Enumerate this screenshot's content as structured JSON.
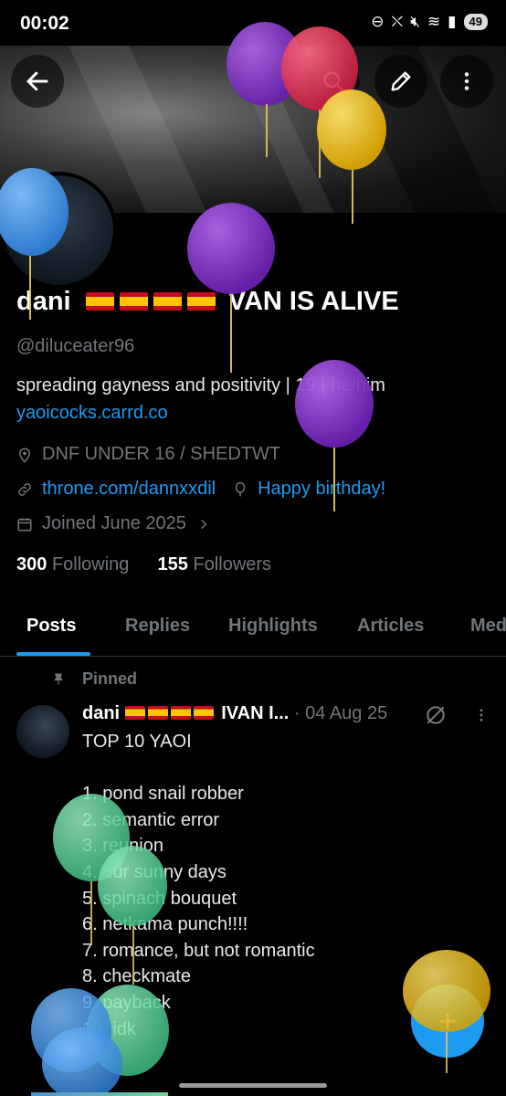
{
  "status_bar": {
    "time": "00:02",
    "battery": "49",
    "signal_label": "5"
  },
  "header": {
    "back_icon": "arrow-left-icon",
    "search_icon": "search-icon",
    "edit_icon": "pencil-icon",
    "more_icon": "more-vertical-icon"
  },
  "profile": {
    "display_name_text": "VAN IS ALIVE",
    "display_name_prefix": "dani",
    "handle": "@diluceater96",
    "bio": "spreading gayness and positivity | 19 | he/him",
    "bio_link": "yaoicocks.carrd.co",
    "location": "DNF UNDER 16 / SHEDTWT",
    "website": "throne.com/dannxxdil",
    "birthday": "Happy birthday!",
    "joined": "Joined June 2025",
    "following_count": "300",
    "following_label": "Following",
    "followers_count": "155",
    "followers_label": "Followers"
  },
  "tabs": [
    {
      "label": "Posts"
    },
    {
      "label": "Replies"
    },
    {
      "label": "Highlights"
    },
    {
      "label": "Articles"
    },
    {
      "label": "Med"
    }
  ],
  "pinned_post": {
    "pinned_label": "Pinned",
    "author": "dani",
    "author_suffix": "IVAN I...",
    "date": "· 04 Aug 25",
    "body": "TOP 10 YAOI\n\n1. pond snail robber\n2. semantic error\n3. reunion\n4. our sunny days\n5. spinach bouquet\n6. netkama punch!!!!\n7. romance, but not romantic\n8. checkmate\n9. payback\n10. idk"
  },
  "fab": {
    "label": "+"
  },
  "colors": {
    "accent": "#1d9bf0",
    "muted": "#71767b",
    "text": "#e7e9ea",
    "background": "#000000"
  }
}
